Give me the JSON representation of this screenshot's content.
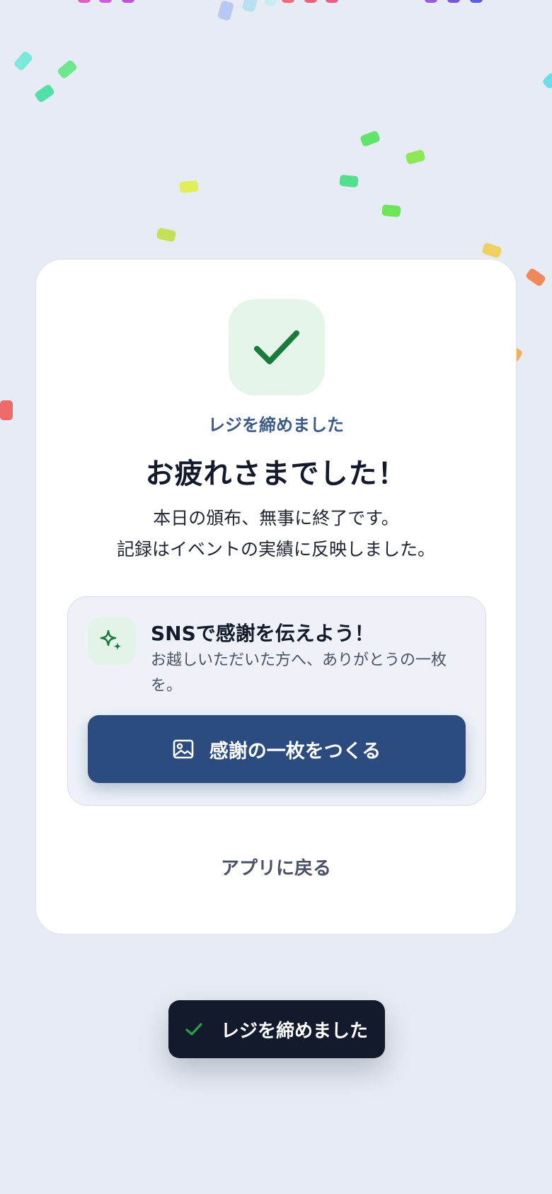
{
  "colors": {
    "background": "#e6ebf4",
    "card": "#ffffff",
    "accent_green": "#1a7a3c",
    "primary_button": "#2c4c80",
    "toast": "#121a2b"
  },
  "completion_card": {
    "icon": "check-icon",
    "eyebrow": "レジを締めました",
    "title": "お疲れさまでした！",
    "body_line1": "本日の頒布、無事に終了です。",
    "body_line2": "記録はイベントの実績に反映しました。"
  },
  "sns_box": {
    "icon": "sparkle-icon",
    "title": "SNSで感謝を伝えよう！",
    "subtitle": "お越しいただいた方へ、ありがとうの一枚を。",
    "button_icon": "image-icon",
    "button_label": "感謝の一枚をつくる"
  },
  "back_link": "アプリに戻る",
  "toast": {
    "icon": "check-icon",
    "message": "レジを締めました"
  }
}
